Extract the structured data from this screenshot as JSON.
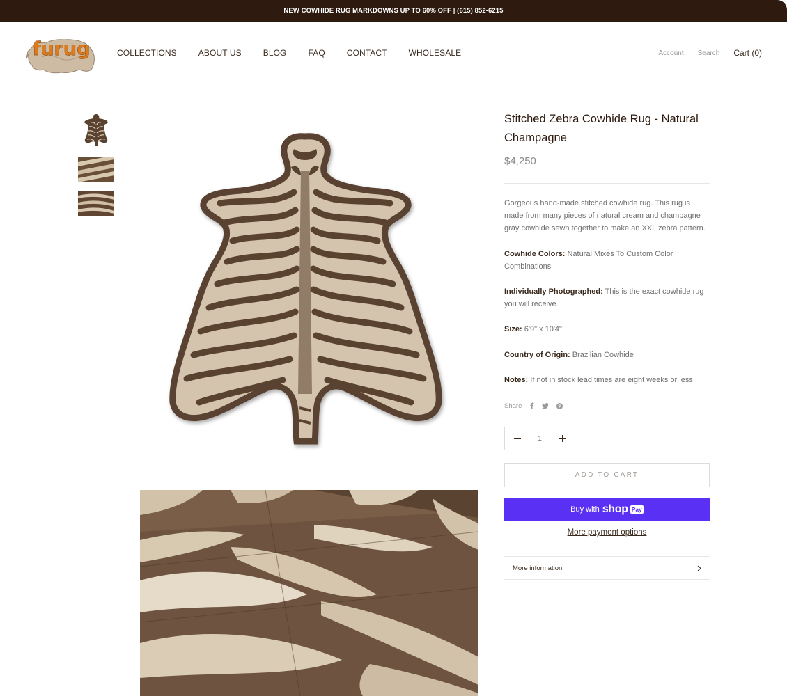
{
  "announcement": "NEW COWHIDE RUG MARKDOWNS UP TO 60% OFF | (615) 852-6215",
  "brand": {
    "logo_text": "furug",
    "logo_color": "#e07b1b"
  },
  "nav": [
    "COLLECTIONS",
    "ABOUT US",
    "BLOG",
    "FAQ",
    "CONTACT",
    "WHOLESALE"
  ],
  "header_utils": {
    "account": "Account",
    "search": "Search",
    "cart": "Cart (0)"
  },
  "product": {
    "title": "Stitched Zebra Cowhide Rug - Natural Champagne",
    "price": "$4,250",
    "description": "Gorgeous hand-made stitched cowhide rug.  This rug is made from many pieces of natural cream and champagne gray cowhide sewn together to make an XXL zebra pattern.",
    "specs": [
      {
        "label": "Cowhide Colors:",
        "value": " Natural Mixes To Custom Color Combinations"
      },
      {
        "label": "Individually Photographed:",
        "value": " This is the exact cowhide rug you will receive."
      },
      {
        "label": "Size:",
        "value": " 6'9\" x 10'4\""
      },
      {
        "label": "Country of Origin:",
        "value": " Brazilian Cowhide"
      },
      {
        "label": "Notes:",
        "value": " If not in stock lead times are eight weeks or less"
      }
    ],
    "share_label": "Share",
    "share_icons": [
      "facebook-icon",
      "twitter-icon",
      "pinterest-icon"
    ],
    "quantity": "1",
    "add_to_cart": "ADD TO CART",
    "buy_with": "Buy with",
    "shop_brand": "shop",
    "pay_badge": "Pay",
    "more_payment": "More payment options",
    "more_info": "More information"
  },
  "colors": {
    "announcement_bg": "#2e1a0e",
    "shop_pay": "#5a31f4",
    "hide_dark": "#5a4230",
    "hide_light": "#d4c4ae"
  }
}
